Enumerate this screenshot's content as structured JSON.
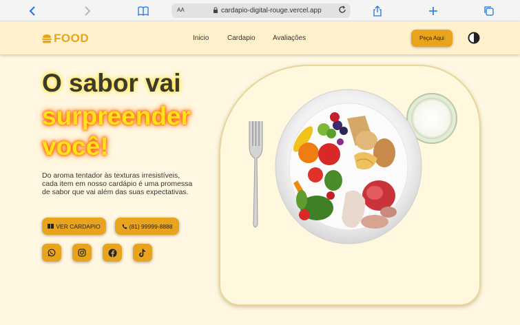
{
  "browser": {
    "text_size_label": "AA",
    "url": "cardapio-digital-rouge.vercel.app"
  },
  "header": {
    "logo_text": "FOOD",
    "nav": [
      "Inicio",
      "Cardapio",
      "Avaliações"
    ],
    "order_button": "Peça Aqui"
  },
  "hero": {
    "title_line1": "O sabor vai",
    "title_line2": "surpreender",
    "title_line3": "você!",
    "description": "Do aroma tentador às texturas irresistíveis, cada item em nosso cardápio é uma promessa de sabor que vai além das suas expectativas.",
    "menu_button": "VER CARDAPIO",
    "phone_button": "(81) 99999-8888",
    "social": [
      "whatsapp-icon",
      "instagram-icon",
      "facebook-icon",
      "tiktok-icon"
    ]
  },
  "colors": {
    "accent": "#e8a41c",
    "background": "#fff7e1",
    "header": "#fff1cc"
  }
}
